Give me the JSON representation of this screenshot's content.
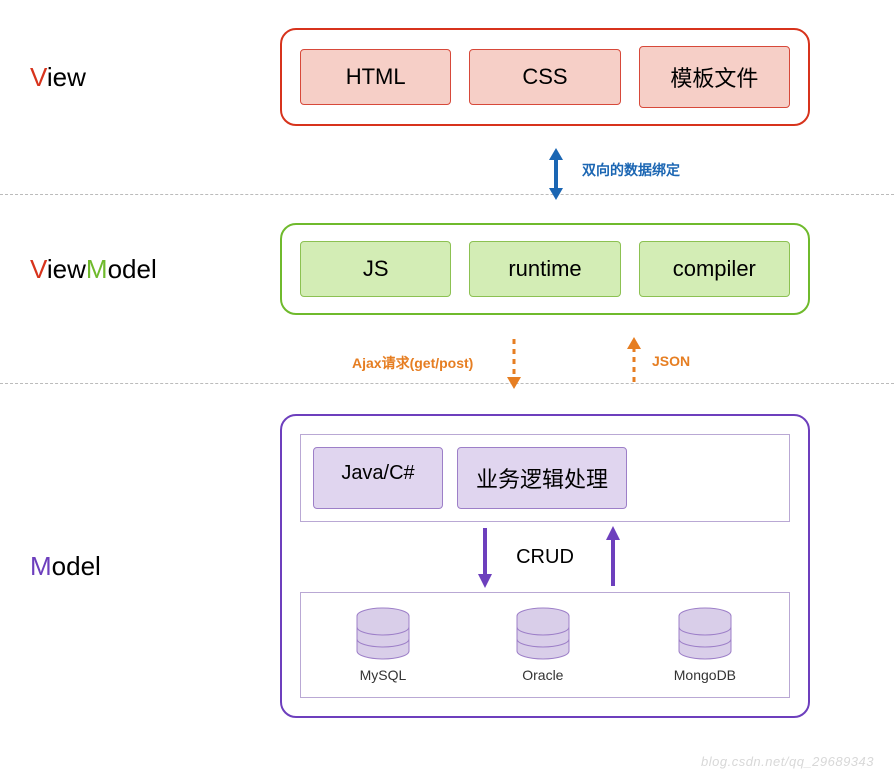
{
  "view": {
    "label_prefix": "V",
    "label_rest": "iew",
    "cards": [
      "HTML",
      "CSS",
      "模板文件"
    ]
  },
  "binding_label": "双向的数据绑定",
  "viewmodel": {
    "label_prefix": "V",
    "label_mid1": "iew",
    "label_accent": "M",
    "label_mid2": "odel",
    "cards": [
      "JS",
      "runtime",
      "compiler"
    ]
  },
  "ajax_label": "Ajax请求(get/post)",
  "json_label": "JSON",
  "model": {
    "label_prefix": "M",
    "label_rest": "odel",
    "top_cards": [
      "Java/C#",
      "业务逻辑处理"
    ],
    "crud_label": "CRUD",
    "dbs": [
      "MySQL",
      "Oracle",
      "MongoDB"
    ]
  },
  "watermark": "blog.csdn.net/qq_29689343"
}
